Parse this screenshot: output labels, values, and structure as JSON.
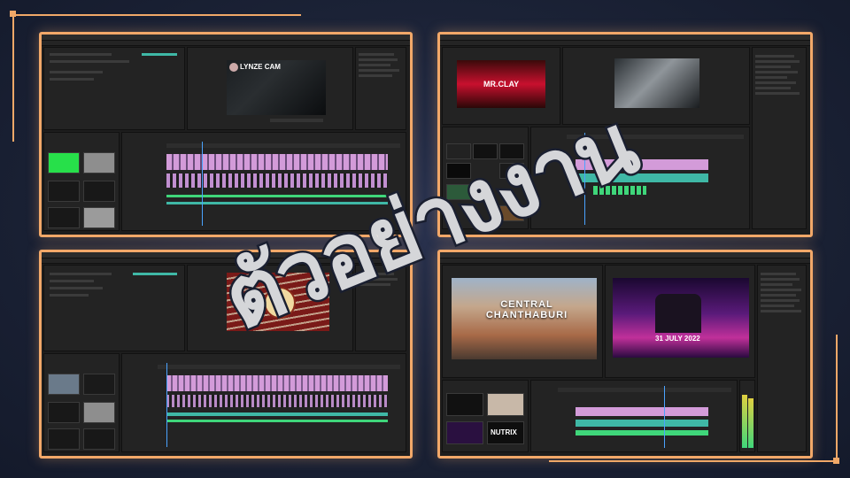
{
  "watermark": {
    "text": "ตัวอย่างงาน"
  },
  "panels": [
    {
      "id": "panel-1",
      "monitor_title": "LYNZE CAM"
    },
    {
      "id": "panel-2",
      "monitor_title": "MR.CLAY"
    },
    {
      "id": "panel-3",
      "monitor_title": ""
    },
    {
      "id": "panel-4",
      "monitor_title": "CENTRAL CHANTHABURI",
      "promo_date": "31 JULY 2022",
      "brand_thumb": "NUTRIX"
    }
  ],
  "colors": {
    "accent": "#f2a869",
    "clip_pink": "#d39bd9",
    "clip_teal": "#3fb8a6",
    "clip_green": "#3fd67a",
    "playhead": "#4aa3ff"
  }
}
